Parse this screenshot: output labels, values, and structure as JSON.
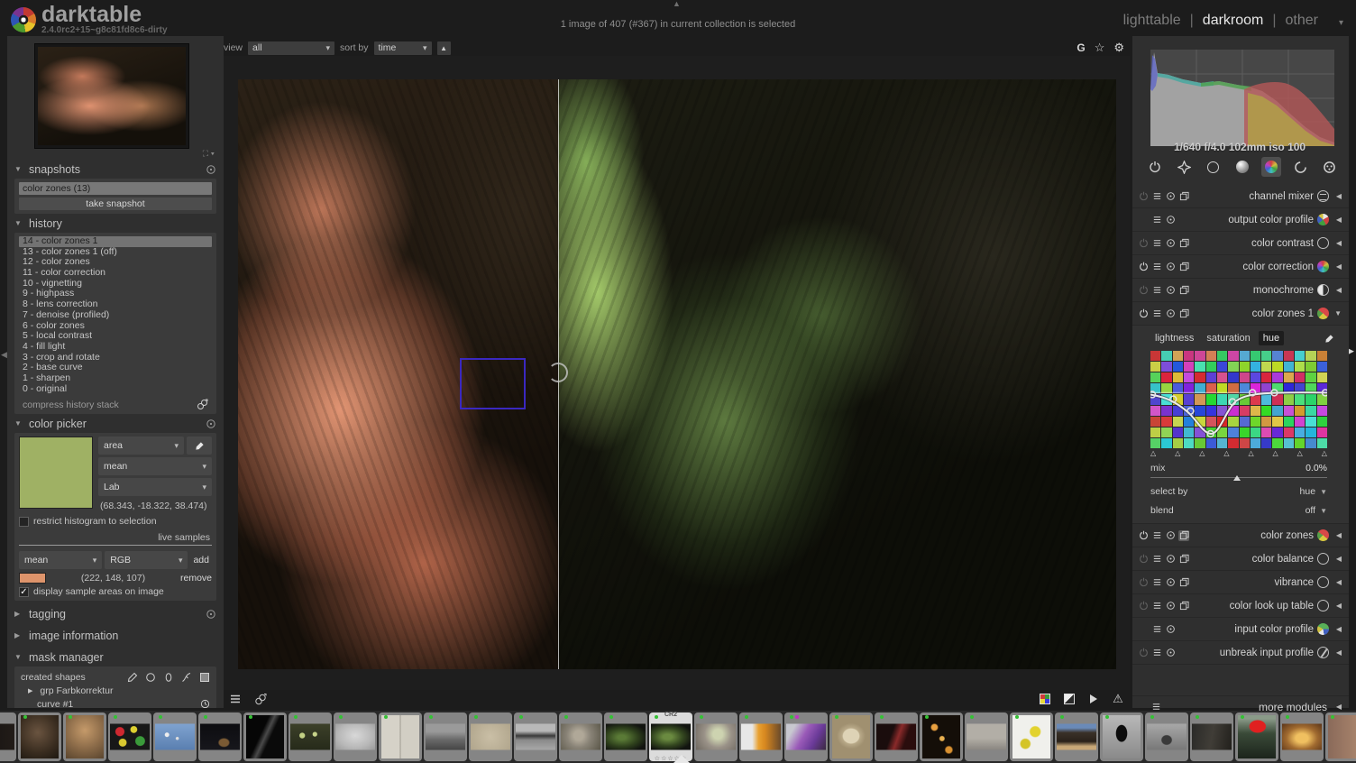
{
  "topbar": {
    "app_name": "darktable",
    "version": "2.4.0rc2+15~g8c81fd8c6-dirty",
    "status": "1 image of 407 (#367) in current collection is selected",
    "views": [
      "lighttable",
      "darkroom",
      "other"
    ],
    "active_view": "darkroom"
  },
  "center_top": {
    "view_label": "view",
    "view_value": "all",
    "sort_label": "sort by",
    "sort_value": "time",
    "icons": [
      "guides-g",
      "star-filter",
      "gear"
    ]
  },
  "left": {
    "snapshots": {
      "title": "snapshots",
      "items": [
        "color zones (13)"
      ],
      "button": "take snapshot"
    },
    "history": {
      "title": "history",
      "selected_index": 0,
      "items": [
        "14 - color zones 1",
        "13 - color zones 1 (off)",
        "12 - color zones",
        "11 - color correction",
        "10 - vignetting",
        "9 - highpass",
        "8 - lens correction",
        "7 - denoise (profiled)",
        "6 - color zones",
        "5 - local contrast",
        "4 - fill light",
        "3 - crop and rotate",
        "2 - base curve",
        "1 - sharpen",
        "0 - original"
      ],
      "compress_label": "compress history stack"
    },
    "color_picker": {
      "title": "color picker",
      "swatch_color": "#9fb164",
      "mode_value": "area",
      "stat_value": "mean",
      "space_value": "Lab",
      "lab_values": "(68.343, -18.322, 38.474)",
      "restrict_label": "restrict histogram to selection",
      "live_samples_label": "live samples",
      "sample_stat_value": "mean",
      "sample_space_value": "RGB",
      "add_label": "add",
      "sample_color": "rgb(222,148,107)",
      "sample_values": "(222, 148, 107)",
      "remove_label": "remove",
      "display_label": "display sample areas on image"
    },
    "tagging_title": "tagging",
    "image_information_title": "image information",
    "mask_manager": {
      "title": "mask manager",
      "created_shapes_label": "created shapes",
      "rows": [
        "grp Farbkorrektur",
        "curve #1"
      ]
    }
  },
  "right": {
    "histogram_exif": "1/640 f/4.0 102mm iso 100",
    "groups": [
      {
        "name": "active-modules",
        "kind": "power",
        "active": false
      },
      {
        "name": "favorites",
        "kind": "star",
        "active": false
      },
      {
        "name": "basic-group",
        "kind": "outline",
        "active": false
      },
      {
        "name": "tone-group",
        "kind": "tone",
        "active": false
      },
      {
        "name": "color-group",
        "kind": "color",
        "active": true
      },
      {
        "name": "correction-group",
        "kind": "correct",
        "active": false
      },
      {
        "name": "effect-group",
        "kind": "effect",
        "active": false
      }
    ],
    "modules_top": [
      {
        "label": "channel mixer",
        "left": [
          "power-dim",
          "presets",
          "reset",
          "instance"
        ],
        "icon": "mixer",
        "arrow": "left"
      },
      {
        "label": "output color profile",
        "left": [
          "presets",
          "reset"
        ],
        "indent": true,
        "icon": "wheel",
        "arrow": "left"
      },
      {
        "label": "color contrast",
        "left": [
          "power-dim",
          "presets",
          "reset",
          "instance"
        ],
        "icon": "outline",
        "arrow": "left"
      },
      {
        "label": "color correction",
        "left": [
          "power-on",
          "presets",
          "reset",
          "instance"
        ],
        "icon": "rainbow",
        "arrow": "left"
      },
      {
        "label": "monochrome",
        "left": [
          "power-dim",
          "presets",
          "reset",
          "instance"
        ],
        "icon": "half",
        "arrow": "left"
      },
      {
        "label": "color zones 1",
        "left": [
          "power-on",
          "presets",
          "reset",
          "instance"
        ],
        "icon": "pie",
        "arrow": "down"
      }
    ],
    "color_zones_panel": {
      "tabs": [
        "lightness",
        "saturation",
        "hue"
      ],
      "active_tab": "hue",
      "mix_label": "mix",
      "mix_value": "0.0%",
      "select_by_label": "select by",
      "select_by_value": "hue",
      "blend_label": "blend",
      "blend_value": "off"
    },
    "modules_bottom": [
      {
        "label": "color zones",
        "left": [
          "power-on",
          "presets",
          "reset",
          "instance-hl"
        ],
        "icon": "pie",
        "arrow": "left"
      },
      {
        "label": "color balance",
        "left": [
          "power-dim",
          "presets",
          "reset",
          "instance"
        ],
        "icon": "outline",
        "arrow": "left"
      },
      {
        "label": "vibrance",
        "left": [
          "power-dim",
          "presets",
          "reset",
          "instance"
        ],
        "icon": "outline",
        "arrow": "left"
      },
      {
        "label": "color look up table",
        "left": [
          "power-dim",
          "presets",
          "reset",
          "instance"
        ],
        "icon": "outline",
        "arrow": "left"
      },
      {
        "label": "input color profile",
        "left": [
          "presets",
          "reset"
        ],
        "indent": true,
        "icon": "wheel2",
        "arrow": "left"
      },
      {
        "label": "unbreak input profile",
        "left": [
          "power-dim",
          "presets",
          "reset"
        ],
        "icon": "slash",
        "arrow": "left"
      }
    ],
    "more_modules_label": "more modules"
  },
  "filmstrip": {
    "selected_format": "CR2",
    "selected_stars": "☆☆☆☆☆",
    "items": [
      {
        "name": "dark-edge",
        "kind": "land",
        "bg": "linear-gradient(90deg,#131110,#221c18)"
      },
      {
        "name": "boar-face",
        "kind": "full",
        "bg": "radial-gradient(circle at 45% 40%, #6a5440, #3a2d20 60%, #1d1710)"
      },
      {
        "name": "deer-eye",
        "kind": "full",
        "bg": "radial-gradient(circle at 50% 35%, #c59a6a, #8a6a48 55%, #5a452e)"
      },
      {
        "name": "peppers",
        "kind": "land",
        "bg": "radial-gradient(circle at 25% 30%, #d02830 0 12%, rgba(0,0,0,0) 14%), radial-gradient(circle at 60% 22%, #ddd030 0 10%, rgba(0,0,0,0) 12%), radial-gradient(circle at 76% 66%, #3a9a3a 0 13%, rgba(0,0,0,0) 15%), radial-gradient(circle at 32% 72%, #d8c830 0 11%, rgba(0,0,0,0) 13%), #181818"
      },
      {
        "name": "branch-sky",
        "kind": "land",
        "bg": "radial-gradient(circle at 30% 42%, #eee 0 6%, rgba(0,0,0,0) 8%), radial-gradient(circle at 56% 56%, #ddd 0 5%, rgba(0,0,0,0) 7%), linear-gradient(180deg,#7fa3d0,#5a7fb0)"
      },
      {
        "name": "cigarette-smoke",
        "kind": "land",
        "bg": "radial-gradient(ellipse at 60% 72%, #7a5a34 0 14%, rgba(0,0,0,0) 18%), linear-gradient(#0c0c10,#17171c)"
      },
      {
        "name": "dark-streaks",
        "kind": "full",
        "bg": "linear-gradient(115deg, #060606 40%, #4a4a4a 50%, #0a0a0a 60%)"
      },
      {
        "name": "plant-sprouts",
        "kind": "land",
        "bg": "radial-gradient(circle at 30% 45%, #c2d084 0 8%, rgba(0,0,0,0) 10%), radial-gradient(circle at 62% 40%, #c8d48a 0 7%, rgba(0,0,0,0) 9%), linear-gradient(#3c4029,#262a1a)"
      },
      {
        "name": "washbasin",
        "kind": "land",
        "bg": "radial-gradient(ellipse at 50% 45%, #d8d8d8, #b8b8b8 60%, #9a9a9a)"
      },
      {
        "name": "cracked-wall",
        "kind": "full",
        "bg": "linear-gradient(90deg, #d6d2c8 47%, #a8a49a 50%, #d2cec4 53%)"
      },
      {
        "name": "city-bw",
        "kind": "land",
        "bg": "linear-gradient(#9a9a9a 30%, #6a6a6a 60%, #454545)"
      },
      {
        "name": "gravel",
        "kind": "land",
        "bg": "radial-gradient(circle at 50% 50%, #cabfa6, #b0a58c)"
      },
      {
        "name": "panorama-bw",
        "kind": "land",
        "bg": "linear-gradient(#b8b8b8 28%, #3a3a3a 46%, #8a8a8a 62%, #a8a8a8)"
      },
      {
        "name": "padlocks-blur",
        "kind": "land",
        "bg": "radial-gradient(circle at 45% 45%, #b0a898 0 18%, #8a8478 45%, #5a5648)"
      },
      {
        "name": "fern-dark",
        "kind": "land",
        "bg": "radial-gradient(ellipse at 40% 52%, #5a7a36 0 12%, #2e401c 48%, #121410 78%)"
      },
      {
        "name": "fern-selected",
        "kind": "land",
        "selected": true,
        "bg": "radial-gradient(ellipse at 42% 50%, #6a8a40 0 14%, #33461f 48%, #121410 78%)"
      },
      {
        "name": "hand-stone",
        "kind": "land",
        "bg": "radial-gradient(circle at 55% 40%, #cdd3b0 0 18%, #9a9288 50%, #6e6860)"
      },
      {
        "name": "juice-glass",
        "kind": "land",
        "bg": "linear-gradient(90deg,#e8e8e8 28%, #e8a030 44%, #d88820 60%, #6a4a2a)"
      },
      {
        "name": "purple-hair",
        "kind": "land",
        "extra_dot": true,
        "bg": "linear-gradient(120deg,#c8c8d0 18%, #9a5ab8 45%, #6a3a98 70%, #3a2a40)"
      },
      {
        "name": "oval-clock",
        "kind": "full",
        "bg": "radial-gradient(ellipse 38% 30% at 50% 48%, #ded3b6 0 55%, #b8a988 62%, #a09070)"
      },
      {
        "name": "red-abstract",
        "kind": "land",
        "bg": "linear-gradient(110deg,#1a0d0d 38%, #8a2a2a 54%, #2a0d0d 72%)"
      },
      {
        "name": "candle-rows",
        "kind": "full",
        "bg": "radial-gradient(circle at 32% 28%, #e8a040 0 7%, rgba(0,0,0,0) 10%), radial-gradient(circle at 52% 54%, #e8b050 0 7%, rgba(0,0,0,0) 10%), radial-gradient(circle at 70% 80%, #d89030 0 7%, rgba(0,0,0,0) 10%), #140e08"
      },
      {
        "name": "graffiti-wall",
        "kind": "land",
        "bg": "linear-gradient(#b2aea6 55%, #8a8680)"
      },
      {
        "name": "yellow-leaves",
        "kind": "full",
        "bg": "radial-gradient(circle at 60% 38%, #e2d22e 0 14%, rgba(0,0,0,0) 17%), radial-gradient(circle at 34% 66%, #d4c426 0 12%, rgba(0,0,0,0) 15%), #f0f0ec"
      },
      {
        "name": "spaniel-dog",
        "kind": "land",
        "bg": "linear-gradient(#6a8ab8 16%, #3a3128 34%, #2a221a 68%, #c8a878 86%)"
      },
      {
        "name": "arched-window",
        "kind": "full",
        "bg": "radial-gradient(ellipse 26% 34% at 50% 42%, #0d0d0d 0 55%, rgba(0,0,0,0) 60%), linear-gradient(#b8b8b8,#8a8a8a)"
      },
      {
        "name": "stone-arch",
        "kind": "land",
        "bg": "radial-gradient(ellipse 30% 42% at 50% 62%, #3a3a3a 0 40%, rgba(0,0,0,0) 48%), linear-gradient(#a8a8a8,#787878)"
      },
      {
        "name": "dark-roof",
        "kind": "land",
        "bg": "linear-gradient(100deg,#2a2a28,#403d37 50%,#22201c)"
      },
      {
        "name": "red-tulip",
        "kind": "full",
        "bg": "radial-gradient(ellipse 30% 20% at 52% 26%, #e02020 0 70%, rgba(0,0,0,0) 76%), linear-gradient(#8a9a88 8%, #3a4a38 42%, #1c241c)"
      },
      {
        "name": "candle-glass",
        "kind": "land",
        "bg": "radial-gradient(ellipse at 50% 55%, #f0c060 0 22%, #a06a30 55%, #5a3418)"
      },
      {
        "name": "face-edge",
        "kind": "full",
        "bg": "linear-gradient(90deg,#8a6a5a,#b08a70)"
      }
    ]
  }
}
